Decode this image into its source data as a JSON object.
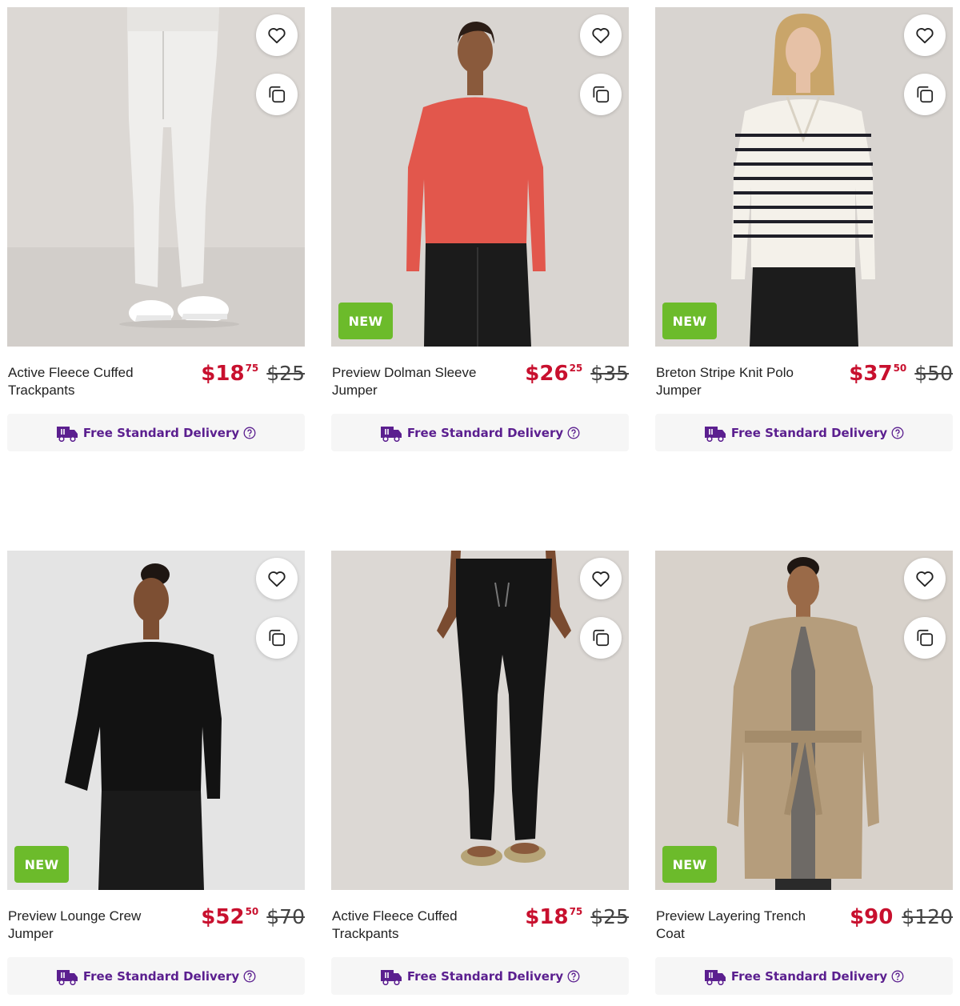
{
  "colors": {
    "price_red": "#c8102e",
    "delivery_purple": "#5b1f8f",
    "new_badge_green": "#6cbb2b",
    "delivery_bg": "#f6f6f6"
  },
  "icons": {
    "wishlist": "heart-icon",
    "compare": "compare-icon",
    "delivery": "delivery-truck-icon",
    "help": "help-circle-icon"
  },
  "products": [
    {
      "name": "Active Fleece Cuffed Trackpants",
      "price_dollars": "$18",
      "price_cents": "75",
      "was_price": "$25",
      "badge": "",
      "delivery_label": "Free Standard Delivery",
      "image": "model-white-trackpants"
    },
    {
      "name": "Preview Dolman Sleeve Jumper",
      "price_dollars": "$26",
      "price_cents": "25",
      "was_price": "$35",
      "badge": "NEW",
      "delivery_label": "Free Standard Delivery",
      "image": "model-coral-jumper"
    },
    {
      "name": "Breton Stripe Knit Polo Jumper",
      "price_dollars": "$37",
      "price_cents": "50",
      "was_price": "$50",
      "badge": "NEW",
      "delivery_label": "Free Standard Delivery",
      "image": "model-striped-polo-jumper"
    },
    {
      "name": "Preview Lounge Crew Jumper",
      "price_dollars": "$52",
      "price_cents": "50",
      "was_price": "$70",
      "badge": "NEW",
      "delivery_label": "Free Standard Delivery",
      "image": "model-black-crew-jumper"
    },
    {
      "name": "Active Fleece Cuffed Trackpants",
      "price_dollars": "$18",
      "price_cents": "75",
      "was_price": "$25",
      "badge": "",
      "delivery_label": "Free Standard Delivery",
      "image": "model-black-trackpants"
    },
    {
      "name": "Preview Layering Trench Coat",
      "price_dollars": "$90",
      "price_cents": "",
      "was_price": "$120",
      "badge": "NEW",
      "delivery_label": "Free Standard Delivery",
      "image": "model-beige-trench-coat"
    }
  ]
}
